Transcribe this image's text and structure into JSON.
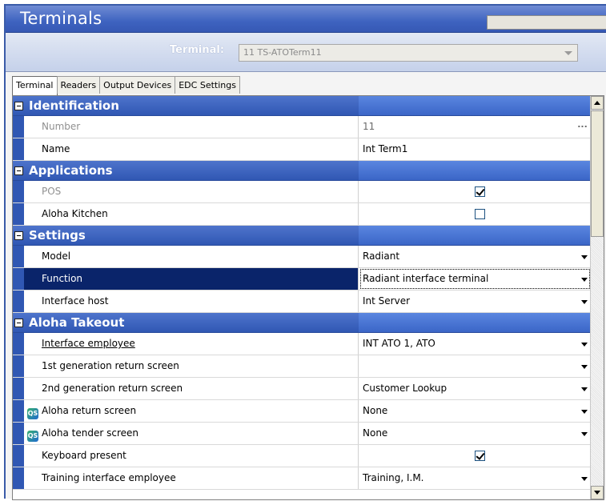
{
  "window": {
    "title": "Terminals"
  },
  "selector": {
    "label": "Terminal:",
    "value": "11 TS-ATOTerm11"
  },
  "tabs": [
    {
      "label": "Terminal",
      "active": true
    },
    {
      "label": "Readers",
      "active": false
    },
    {
      "label": "Output Devices",
      "active": false
    },
    {
      "label": "EDC Settings",
      "active": false
    }
  ],
  "grid": {
    "identification": {
      "label": "Identification",
      "number": {
        "name": "Number",
        "value": "11"
      },
      "name": {
        "name": "Name",
        "value": "Int Term1"
      }
    },
    "applications": {
      "label": "Applications",
      "pos": {
        "name": "POS",
        "checked": true
      },
      "kitchen": {
        "name": "Aloha Kitchen",
        "checked": false
      }
    },
    "settings": {
      "label": "Settings",
      "model": {
        "name": "Model",
        "value": "Radiant"
      },
      "function": {
        "name": "Function",
        "value": "Radiant interface terminal"
      },
      "host": {
        "name": "Interface host",
        "value": "Int Server"
      }
    },
    "takeout": {
      "label": "Aloha Takeout",
      "employee": {
        "name": "Interface employee",
        "value": "INT ATO 1, ATO"
      },
      "first_return": {
        "name": "1st generation return screen",
        "value": ""
      },
      "second_return": {
        "name": "2nd generation return screen",
        "value": "Customer Lookup"
      },
      "aloha_return": {
        "name": "Aloha return screen",
        "value": "None",
        "icon": "qs-icon"
      },
      "aloha_tender": {
        "name": "Aloha tender screen",
        "value": "None",
        "icon": "qs-icon"
      },
      "keyboard": {
        "name": "Keyboard present",
        "checked": true
      },
      "training": {
        "name": "Training interface employee",
        "value": "Training, I.M."
      }
    }
  },
  "colors": {
    "header_blue": "#3e63c0",
    "category_blue": "#3057b3",
    "selected_row": "#0a246a"
  }
}
